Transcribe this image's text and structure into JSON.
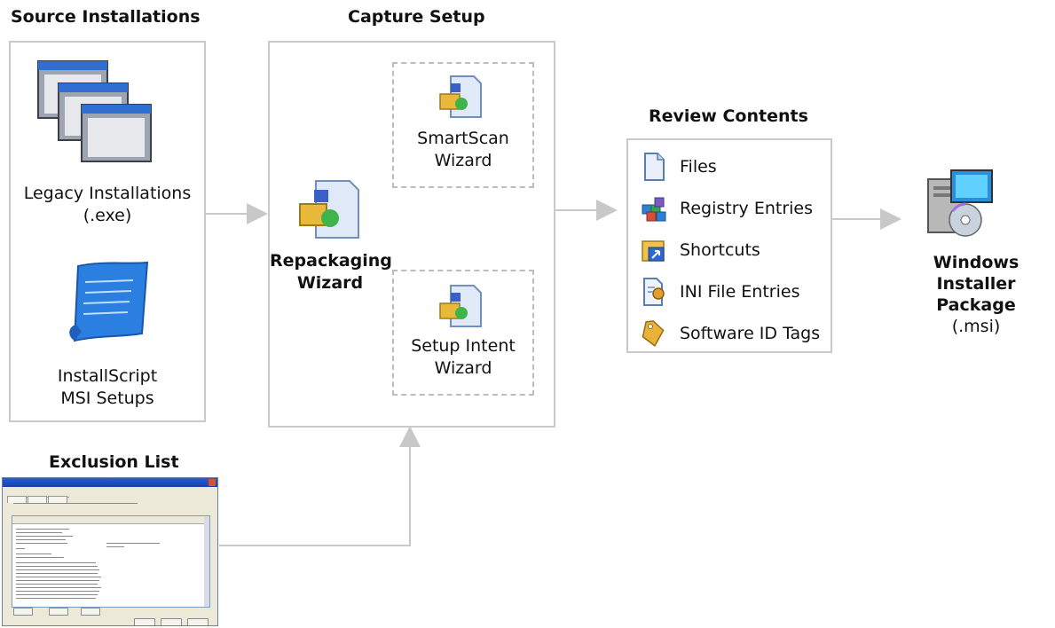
{
  "headings": {
    "source": "Source Installations",
    "capture": "Capture Setup",
    "review": "Review Contents",
    "exclusion": "Exclusion List"
  },
  "source": {
    "legacy_line1": "Legacy Installations",
    "legacy_line2": "(.exe)",
    "installscript_line1": "InstallScript",
    "installscript_line2": "MSI Setups"
  },
  "capture": {
    "repackaging_line1": "Repackaging",
    "repackaging_line2": "Wizard",
    "smartscan_line1": "SmartScan",
    "smartscan_line2": "Wizard",
    "setupintent_line1": "Setup Intent",
    "setupintent_line2": "Wizard"
  },
  "review": {
    "items": [
      {
        "label": "Files",
        "icon": "file-icon"
      },
      {
        "label": "Registry Entries",
        "icon": "registry-icon"
      },
      {
        "label": "Shortcuts",
        "icon": "shortcut-icon"
      },
      {
        "label": "INI File Entries",
        "icon": "ini-file-icon"
      },
      {
        "label": "Software ID Tags",
        "icon": "tag-icon"
      }
    ]
  },
  "output": {
    "line1": "Windows",
    "line2": "Installer Package",
    "line3": "(.msi)"
  },
  "colors": {
    "box_border": "#c9c9c9",
    "arrow": "#c8c8c8",
    "dialog_bg": "#ece9d8",
    "title_bar": "#2a5bd7"
  }
}
